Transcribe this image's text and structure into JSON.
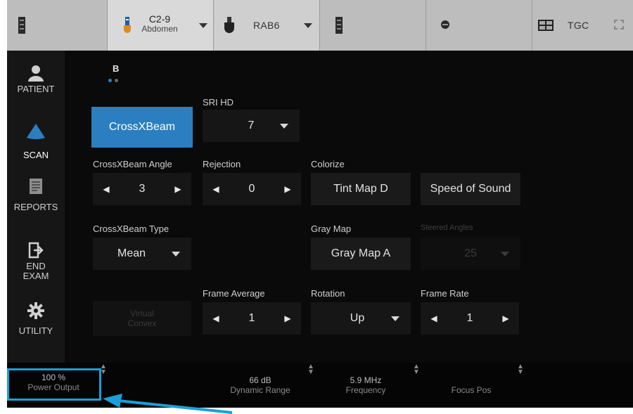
{
  "topbar": {
    "probe1": {
      "name": "C2-9",
      "preset": "Abdomen"
    },
    "probe2": {
      "name": "RAB6"
    },
    "tgc_label": "TGC"
  },
  "sidebar": {
    "items": [
      {
        "label": "PATIENT",
        "icon": "patient-icon"
      },
      {
        "label": "SCAN",
        "icon": "scan-icon"
      },
      {
        "label": "REPORTS",
        "icon": "reports-icon"
      },
      {
        "label": "END EXAM",
        "icon": "end-exam-icon"
      },
      {
        "label": "UTILITY",
        "icon": "utility-icon"
      }
    ],
    "active": "SCAN"
  },
  "mode": {
    "label": "B",
    "page_dots": 2,
    "active_dot": 1
  },
  "controls": {
    "crossxbeam_button": "CrossXBeam",
    "sri_hd": {
      "label": "SRI HD",
      "value": "7"
    },
    "crossxbeam_angle": {
      "label": "CrossXBeam Angle",
      "value": "3"
    },
    "rejection": {
      "label": "Rejection",
      "value": "0"
    },
    "colorize": {
      "label": "Colorize",
      "value": "Tint Map D"
    },
    "speed_of_sound": "Speed of Sound",
    "crossxbeam_type": {
      "label": "CrossXBeam Type",
      "value": "Mean"
    },
    "gray_map": {
      "label": "Gray Map",
      "value": "Gray Map A"
    },
    "steered_angles": {
      "label": "Steered Angles",
      "value": "25"
    },
    "virtual_convex": "Virtual Convex",
    "frame_average": {
      "label": "Frame Average",
      "value": "1"
    },
    "rotation": {
      "label": "Rotation",
      "value": "Up"
    },
    "frame_rate": {
      "label": "Frame Rate",
      "value": "1"
    }
  },
  "bottom": {
    "power_output": {
      "value": "100 %",
      "name": "Power Output"
    },
    "dynamic_range": {
      "value": "66 dB",
      "name": "Dynamic Range"
    },
    "frequency": {
      "value": "5.9 MHz",
      "name": "Frequency"
    },
    "focus_pos": {
      "value": "",
      "name": "Focus Pos"
    }
  },
  "colors": {
    "accent": "#2b7fc0",
    "callout": "#1aa0d6"
  }
}
